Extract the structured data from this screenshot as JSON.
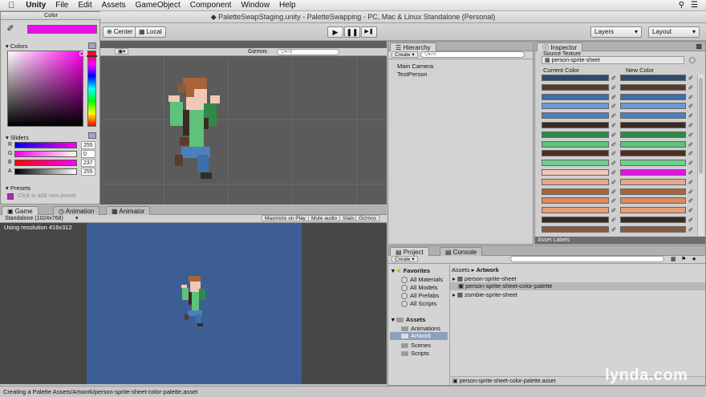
{
  "menubar": {
    "app": "Unity",
    "items": [
      "File",
      "Edit",
      "Assets",
      "GameObject",
      "Component",
      "Window",
      "Help"
    ]
  },
  "title": "PaletteSwapStaging.unity - PaletteSwapping - PC, Mac & Linux Standalone (Personal)",
  "toolbar": {
    "center": "Center",
    "local": "Local",
    "play": "▶",
    "pause": "❚❚",
    "step": "▶❚",
    "layers": "Layers",
    "layout": "Layout"
  },
  "color_window": {
    "title": "Color",
    "colors_label": "Colors",
    "sliders_label": "Sliders",
    "selected_color": "#e80fe8",
    "channels": [
      {
        "label": "R",
        "value": "255"
      },
      {
        "label": "G",
        "value": "0"
      },
      {
        "label": "B",
        "value": "237"
      },
      {
        "label": "A",
        "value": "255"
      }
    ],
    "presets_label": "Presets",
    "presets_hint": "Click to add new preset"
  },
  "scene": {
    "gizmos": "Gizmos",
    "search": "Q▾All"
  },
  "game": {
    "tabs": [
      "Game",
      "Animation",
      "Animator"
    ],
    "resolution": "Standalone (1024x768)",
    "buttons": [
      "Maximize on Play",
      "Mute audio",
      "Stats",
      "Gizmos"
    ],
    "using_resolution": "Using resolution 416x312",
    "bg_color": "#3c5e94"
  },
  "hierarchy": {
    "tab": "Hierarchy",
    "create": "Create",
    "search": "Q▾All",
    "items": [
      "Main Camera",
      "TestPerson"
    ]
  },
  "inspector": {
    "tab": "Inspector",
    "source_label": "Source Texture",
    "source_value": "person-sprite-sheet",
    "current_col": "Current Color",
    "new_col": "New Color",
    "rows": [
      {
        "current": "#2f4a6e",
        "new": "#2f4a6e"
      },
      {
        "current": "#5a3a2a",
        "new": "#5a3a2a"
      },
      {
        "current": "#3d6fa8",
        "new": "#3d6fa8"
      },
      {
        "current": "#6b9bd0",
        "new": "#6b9bd0"
      },
      {
        "current": "#4c80bd",
        "new": "#4c80bd"
      },
      {
        "current": "#3a2a22",
        "new": "#3a2a22"
      },
      {
        "current": "#2e8a46",
        "new": "#2e8a46"
      },
      {
        "current": "#5ec27a",
        "new": "#5ec27a"
      },
      {
        "current": "#4a2e22",
        "new": "#4a2e22"
      },
      {
        "current": "#6fd08c",
        "new": "#6fd08c"
      },
      {
        "current": "#f0c8b8",
        "new": "#e80fe8"
      },
      {
        "current": "#e8a890",
        "new": "#e8a890"
      },
      {
        "current": "#a86438",
        "new": "#a86438"
      },
      {
        "current": "#d88c64",
        "new": "#d88c64"
      },
      {
        "current": "#e89c78",
        "new": "#e89c78"
      },
      {
        "current": "#3a2a22",
        "new": "#3a2a22"
      },
      {
        "current": "#8a5a3a",
        "new": "#8a5a3a"
      }
    ],
    "asset_labels": "Asset Labels"
  },
  "project": {
    "tabs": [
      "Project",
      "Console"
    ],
    "create": "Create",
    "favorites": "Favorites",
    "fav_items": [
      "All Materials",
      "All Models",
      "All Prefabs",
      "All Scripts"
    ],
    "assets": "Assets",
    "asset_folders": [
      "Animations",
      "Artwork",
      "Scenes",
      "Scripts"
    ],
    "breadcrumb": [
      "Assets",
      "Artwork"
    ],
    "files": [
      "person-sprite-sheet",
      "person-sprite-sheet-color-palette",
      "zombie-sprite-sheet"
    ],
    "footer_file": "person-sprite-sheet-color-palette.asset"
  },
  "status": "Creating a Palette Assets/Artwork/person-sprite-sheet-color-palette.asset",
  "watermark": "lynda.com"
}
